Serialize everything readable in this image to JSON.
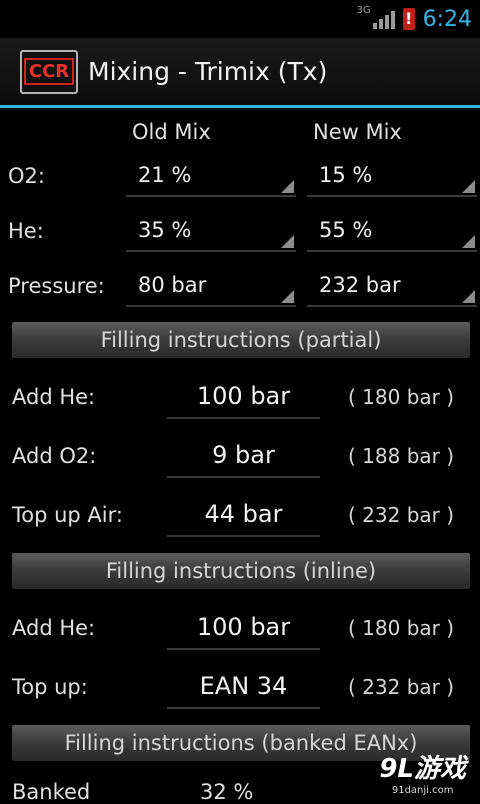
{
  "status_bar": {
    "network": "3G",
    "alert": "!",
    "time": "6:24"
  },
  "header": {
    "logo_text": "CCR",
    "title": "Mixing - Trimix (Tx)"
  },
  "mix": {
    "old_header": "Old Mix",
    "new_header": "New Mix",
    "rows": [
      {
        "label": "O2:",
        "old": "21 %",
        "new": "15 %"
      },
      {
        "label": "He:",
        "old": "35 %",
        "new": "55 %"
      },
      {
        "label": "Pressure:",
        "old": "80 bar",
        "new": "232 bar"
      }
    ]
  },
  "partial": {
    "title": "Filling instructions (partial)",
    "rows": [
      {
        "label": "Add He:",
        "value": "100 bar",
        "total": "( 180 bar )"
      },
      {
        "label": "Add O2:",
        "value": "9 bar",
        "total": "( 188 bar )"
      },
      {
        "label": "Top up Air:",
        "value": "44 bar",
        "total": "( 232 bar )"
      }
    ]
  },
  "inline": {
    "title": "Filling instructions (inline)",
    "rows": [
      {
        "label": "Add He:",
        "value": "100 bar",
        "total": "( 180 bar )"
      },
      {
        "label": "Top up:",
        "value": "EAN 34",
        "total": "( 232 bar )"
      }
    ]
  },
  "banked": {
    "title": "Filling instructions (banked EANx)",
    "row_label": "Banked",
    "row_value": "32 %"
  },
  "watermark": {
    "main": "9L游戏",
    "sub": "91danji.com"
  }
}
